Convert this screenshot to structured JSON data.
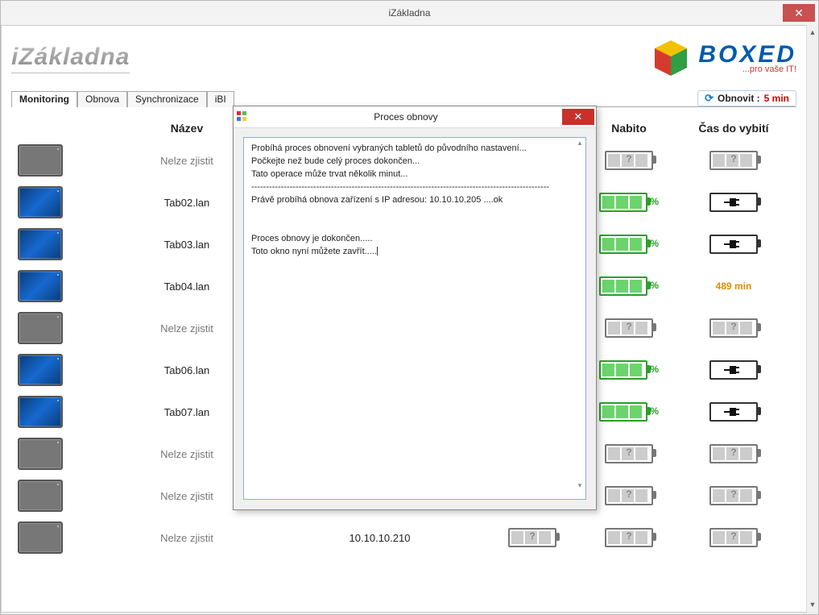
{
  "window_title": "iZákladna",
  "brand_logo_text": "iZákladna",
  "boxed": {
    "word": "BOXED",
    "slogan": "...pro vaše IT!"
  },
  "tabs": [
    "Monitoring",
    "Obnova",
    "Synchronizace",
    "iBI"
  ],
  "active_tab": "Monitoring",
  "refresh": {
    "label": "Obnovit :",
    "value": "5 min"
  },
  "columns": {
    "name": "Název",
    "charged": "Nabito",
    "time": "Čas do vybití"
  },
  "rows": [
    {
      "online": false,
      "name": "Nelze zjistit",
      "ip": "",
      "pct": "",
      "time": "?",
      "charging": false,
      "battUnknown": true
    },
    {
      "online": true,
      "name": "Tab02.lan",
      "ip": "",
      "pct": "%",
      "time": "plug",
      "charging": true,
      "battUnknown": false
    },
    {
      "online": true,
      "name": "Tab03.lan",
      "ip": "",
      "pct": "%",
      "time": "plug",
      "charging": true,
      "battUnknown": false
    },
    {
      "online": true,
      "name": "Tab04.lan",
      "ip": "",
      "pct": "%",
      "time": "489 min",
      "time_color": "orange",
      "charging": false,
      "battUnknown": false
    },
    {
      "online": false,
      "name": "Nelze zjistit",
      "ip": "",
      "pct": "",
      "time": "?",
      "charging": false,
      "battUnknown": true
    },
    {
      "online": true,
      "name": "Tab06.lan",
      "ip": "",
      "pct": "%",
      "time": "plug",
      "charging": true,
      "battUnknown": false
    },
    {
      "online": true,
      "name": "Tab07.lan",
      "ip": "",
      "pct": "%",
      "time": "plug",
      "charging": true,
      "battUnknown": false
    },
    {
      "online": false,
      "name": "Nelze zjistit",
      "ip": "",
      "pct": "",
      "time": "?",
      "charging": false,
      "battUnknown": true
    },
    {
      "online": false,
      "name": "Nelze zjistit",
      "ip": "",
      "pct": "",
      "time": "?",
      "charging": false,
      "battUnknown": true
    },
    {
      "online": false,
      "name": "Nelze zjistit",
      "ip": "10.10.10.210",
      "pct": "?",
      "time": "?",
      "charging": false,
      "battUnknown": true
    }
  ],
  "dialog": {
    "title": "Proces obnovy",
    "lines": [
      "Probíhá proces obnovení vybraných tabletů do původního nastavení...",
      "Počkejte než bude celý proces dokončen...",
      "Tato operace může trvat několik minut...",
      "-----------------------------------------------------------------------------------------------------",
      "Právě probíhá obnova zařízení s IP adresou: 10.10.10.205 ....ok",
      "",
      "",
      "Proces obnovy je dokončen.....",
      "Toto okno nyní můžete zavřít....."
    ]
  }
}
